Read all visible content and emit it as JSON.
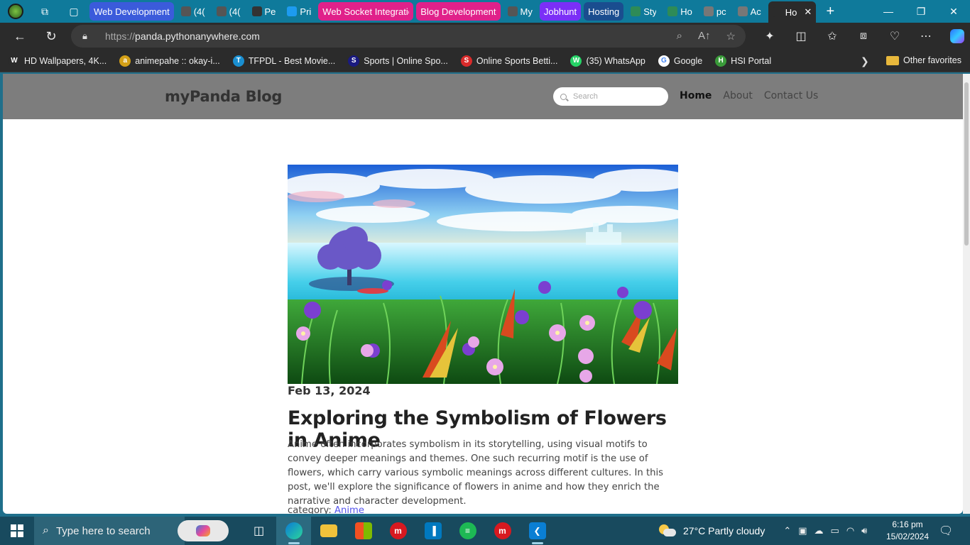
{
  "browser": {
    "tabs": [
      {
        "label": "Web Development",
        "color": "#3b5bdb",
        "kind": "group"
      },
      {
        "label": "(4(",
        "color": "#555555",
        "kind": "tab"
      },
      {
        "label": "(4(",
        "color": "#555555",
        "kind": "tab"
      },
      {
        "label": "Pe",
        "color": "#333333",
        "kind": "tab"
      },
      {
        "label": "Pri",
        "color": "#1d9bf0",
        "kind": "tab"
      },
      {
        "label": "Web Socket Integratio",
        "color": "#e0218a",
        "kind": "group"
      },
      {
        "label": "Blog Development",
        "color": "#e0218a",
        "kind": "group"
      },
      {
        "label": "My",
        "color": "#555555",
        "kind": "tab"
      },
      {
        "label": "Jobhunt",
        "color": "#7b2ff7",
        "kind": "group"
      },
      {
        "label": "Hosting",
        "color": "#1a4d8f",
        "kind": "group"
      },
      {
        "label": "Sty",
        "color": "#2e8b57",
        "kind": "tab"
      },
      {
        "label": "Ho",
        "color": "#2e8b57",
        "kind": "tab"
      },
      {
        "label": "pc",
        "color": "#777777",
        "kind": "tab"
      },
      {
        "label": "Ac",
        "color": "#777777",
        "kind": "tab"
      },
      {
        "label": "Ho",
        "color": "#2b2b2b",
        "kind": "active"
      }
    ],
    "url_scheme": "https://",
    "url_host": "panda.pythonanywhere.com",
    "favorites": [
      {
        "label": "HD Wallpapers, 4K...",
        "icon_color": "#2b2b2b",
        "glyph": "W"
      },
      {
        "label": "animepahe :: okay-i...",
        "icon_color": "#d4a017",
        "glyph": "a"
      },
      {
        "label": "TFPDL - Best Movie...",
        "icon_color": "#1a8fd1",
        "glyph": "T"
      },
      {
        "label": "Sports | Online Spo...",
        "icon_color": "#1a1a80",
        "glyph": "S"
      },
      {
        "label": "Online Sports Betti...",
        "icon_color": "#d92b2b",
        "glyph": "S"
      },
      {
        "label": "(35) WhatsApp",
        "icon_color": "#25d366",
        "glyph": "W"
      },
      {
        "label": "Google",
        "icon_color": "#ffffff",
        "glyph": "G"
      },
      {
        "label": "HSI Portal",
        "icon_color": "#3a9b3a",
        "glyph": "H"
      }
    ],
    "other_favorites": "Other favorites"
  },
  "site": {
    "brand": "myPanda Blog",
    "search_placeholder": "Search",
    "nav": [
      {
        "label": "Home",
        "active": true
      },
      {
        "label": "About",
        "active": false
      },
      {
        "label": "Contact Us",
        "active": false
      }
    ]
  },
  "post": {
    "date": "Feb 13, 2024",
    "title": "Exploring the Symbolism of Flowers in Anime",
    "body": "Anime often incorporates symbolism in its storytelling, using visual motifs to convey deeper meanings and themes. One such recurring motif is the use of flowers, which carry various symbolic meanings across different cultures. In this post, we'll explore the significance of flowers in anime and how they enrich the narrative and character development.",
    "category_label": "category:",
    "category": "Anime"
  },
  "taskbar": {
    "search_placeholder": "Type here to search",
    "weather_temp": "27°C",
    "weather_desc": "Partly cloudy",
    "time": "6:16 pm",
    "date": "15/02/2024"
  }
}
